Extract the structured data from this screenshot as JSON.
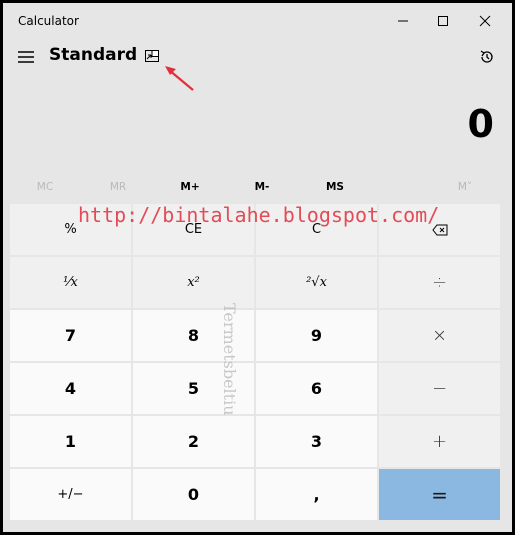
{
  "window": {
    "title": "Calculator"
  },
  "header": {
    "mode": "Standard"
  },
  "display": {
    "value": "0"
  },
  "memory": [
    "MC",
    "MR",
    "M+",
    "M-",
    "MS",
    "M˅"
  ],
  "keys": {
    "percent": "%",
    "ce": "CE",
    "c": "C",
    "backspace_icon": "backspace-icon",
    "reciprocal": "⅟x",
    "square": "x²",
    "sqrt": "²√x",
    "divide": "÷",
    "seven": "7",
    "eight": "8",
    "nine": "9",
    "multiply": "×",
    "four": "4",
    "five": "5",
    "six": "6",
    "minus": "−",
    "one": "1",
    "two": "2",
    "three": "3",
    "plus": "+",
    "negate": "+/−",
    "zero": "0",
    "decimal": ",",
    "equals": "="
  },
  "watermarks": {
    "url": "http://bintalahe.blogspot.com/",
    "vertical": "Termetsbeltiu"
  },
  "colors": {
    "background": "#e6e6e6",
    "equals": "#8ab8e0",
    "annotation": "#e0303c"
  }
}
